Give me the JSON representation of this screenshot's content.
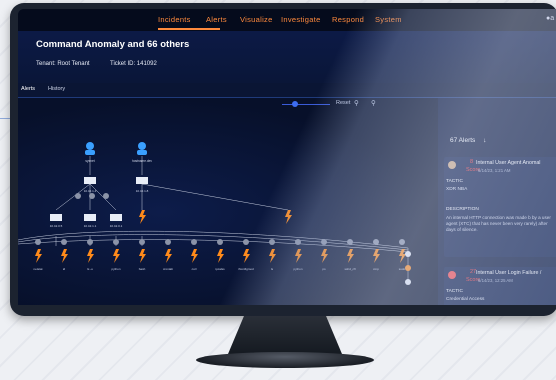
{
  "nav": {
    "tabs": [
      "Incidents",
      "Alerts",
      "Visualize",
      "Investigate",
      "Respond",
      "System"
    ],
    "user_label": "a"
  },
  "header": {
    "title": "Command Anomaly and 66 others",
    "tenant": "Tenant:  Root Tenant",
    "ticket": "Ticket ID:  141092"
  },
  "subtabs": [
    "Alerts",
    "History"
  ],
  "graph_toolbar": {
    "reset_label": "Reset"
  },
  "graph": {
    "top_users": [
      "sysnet",
      "hostname.dev"
    ],
    "hosts": [
      "10.42.1.4",
      "10.42.1.8"
    ],
    "sub_hosts": [
      "10.42.0.5",
      "10.42.1.1",
      "10.42.0.1"
    ],
    "bottom_nodes": [
      "netstat",
      "id",
      "ls -u",
      "python",
      "bash",
      "crontab",
      "curl",
      "ipcalss",
      "ifconfigmod",
      "ls",
      "python",
      "ps",
      "sshd_cfl",
      "cmp",
      "sudo"
    ]
  },
  "alerts_panel": {
    "count_label": "67 Alerts",
    "sort_icon": "down-arrow",
    "cards": [
      {
        "score": "8",
        "score_label": "Score",
        "title": "Internal User Agent Anomal",
        "date": "6/14/23, 1:21 AM",
        "tactic_label": "TACTIC",
        "tactic": "XDR NBA",
        "description_label": "DESCRIPTION",
        "description": "An internal HTTP connection was made b by a user agent (XTC) that has never been very rarely) after days of silence."
      },
      {
        "score": "27",
        "score_label": "Score",
        "title": "Internal User Login Failure /",
        "date": "6/14/23, 12:25 AM",
        "tactic_label": "TACTIC",
        "tactic": "Credential Access"
      }
    ]
  }
}
